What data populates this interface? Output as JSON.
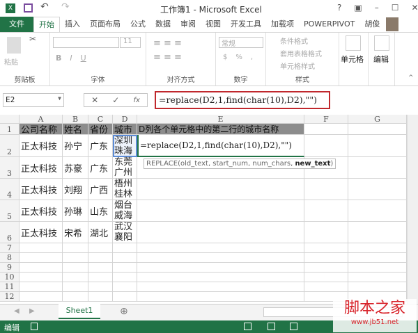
{
  "title": "工作簿1 - Microsoft Excel",
  "window_buttons": [
    "?",
    "▣",
    "–",
    "☐",
    "✕"
  ],
  "tabs": [
    "文件",
    "开始",
    "插入",
    "页面布局",
    "公式",
    "数据",
    "审阅",
    "视图",
    "开发工具",
    "加载项",
    "POWERPIVOT",
    "胡俊"
  ],
  "ribbon": {
    "clipboard": {
      "paste": "粘贴",
      "label": "剪贴板"
    },
    "font": {
      "size": "11",
      "label": "字体",
      "bold": "B",
      "italic": "I",
      "underline": "U"
    },
    "align": {
      "label": "对齐方式"
    },
    "number": {
      "format": "常规",
      "label": "数字",
      "currency": "$",
      "percent": "%",
      "comma": ","
    },
    "styles": {
      "cond": "条件格式",
      "table": "套用表格格式",
      "cell": "单元格样式",
      "label": "样式"
    },
    "cells": {
      "label": "单元格"
    },
    "edit": {
      "label": "编辑"
    }
  },
  "formula_bar": {
    "name_box": "E2",
    "fx": "fx",
    "formula": "=replace(D2,1,find(char(10),D2),\"\")"
  },
  "columns": [
    "A",
    "B",
    "C",
    "D",
    "E",
    "F",
    "G"
  ],
  "rows": [
    {
      "n": "1",
      "cells": [
        "公司名称",
        "姓名",
        "省份",
        "城市",
        "D列各个单元格中的第二行的城市名称"
      ]
    },
    {
      "n": "2",
      "cells": [
        "正太科技",
        "孙宁",
        "广东",
        "深圳\n珠海",
        "=replace(D2,1,find(char(10),D2),\"\")"
      ]
    },
    {
      "n": "3",
      "cells": [
        "正太科技",
        "苏豪",
        "广东",
        "东莞\n广州",
        ""
      ]
    },
    {
      "n": "4",
      "cells": [
        "正太科技",
        "刘翔",
        "广西",
        "梧州\n桂林",
        ""
      ]
    },
    {
      "n": "5",
      "cells": [
        "正太科技",
        "孙琳",
        "山东",
        "烟台\n威海",
        ""
      ]
    },
    {
      "n": "6",
      "cells": [
        "正太科技",
        "宋希",
        "湖北",
        "武汉\n襄阳",
        ""
      ]
    }
  ],
  "empty_rows": [
    "7",
    "8",
    "9",
    "10",
    "11",
    "12"
  ],
  "tooltip": {
    "args": "REPLACE(old_text, start_num, num_chars, ",
    "bold": "new_text",
    ")": ")"
  },
  "sheet_tab": "Sheet1",
  "add_sheet": "⊕",
  "status": {
    "mode": "编辑"
  },
  "watermark": {
    "text": "脚本之家",
    "url": "www.jb51.net"
  }
}
